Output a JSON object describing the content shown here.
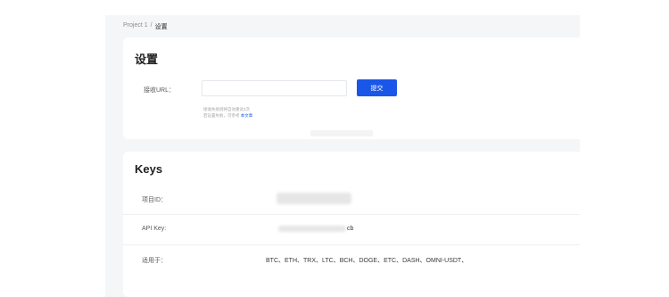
{
  "breadcrumb": {
    "project": "Project 1",
    "separator": "/",
    "current": "设置"
  },
  "settings": {
    "title": "设置",
    "url_label": "接收URL：",
    "url_value": "",
    "url_placeholder": "",
    "submit_label": "提交",
    "hint_line1": "接收失败则将自动重试3次",
    "hint_line2_prefix": "若设置失败，可参考",
    "hint_link": "本文章"
  },
  "keys": {
    "title": "Keys",
    "rows": [
      {
        "label": "项目ID：",
        "value": ""
      },
      {
        "label": "API Key:",
        "value": "cb"
      },
      {
        "label": "适用于：",
        "value": "BTC、ETH、TRX、LTC、BCH、DOGE、ETC、DASH、OMNI-USDT、"
      }
    ]
  },
  "colors": {
    "primary": "#1a56e8",
    "background": "#f5f6f8",
    "card": "#ffffff"
  }
}
